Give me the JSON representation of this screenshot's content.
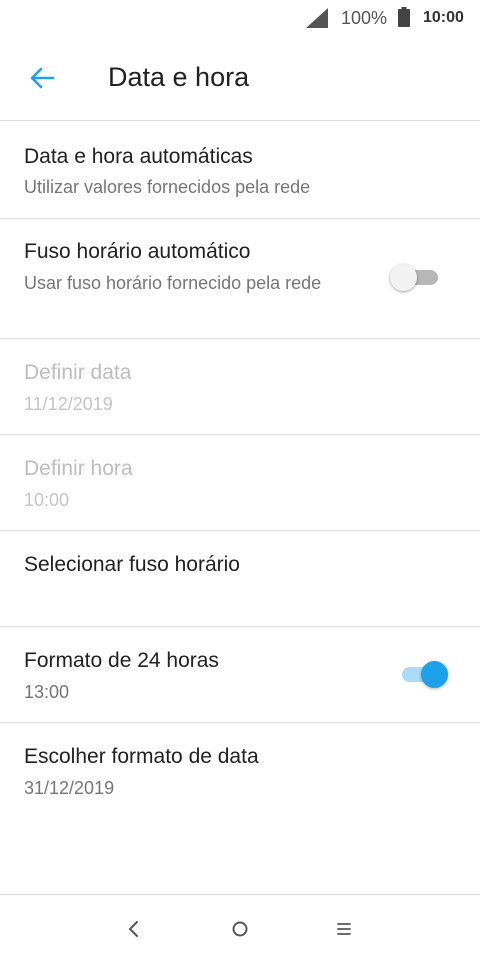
{
  "status_bar": {
    "battery_percent": "100%",
    "time": "10:00",
    "icons": [
      "cell-signal-icon",
      "battery-icon"
    ]
  },
  "app_bar": {
    "title": "Data e hora",
    "back_icon": "arrow-left-icon"
  },
  "settings": {
    "auto_datetime": {
      "title": "Data e hora automáticas",
      "summary": "Utilizar valores fornecidos pela rede"
    },
    "auto_timezone": {
      "title": "Fuso horário automático",
      "summary": "Usar fuso horário fornecido pela rede",
      "enabled": false
    },
    "set_date": {
      "title": "Definir data",
      "value": "11/12/2019",
      "disabled": true
    },
    "set_time": {
      "title": "Definir hora",
      "value": "10:00",
      "disabled": true
    },
    "select_timezone": {
      "title": "Selecionar fuso horário"
    },
    "format_24h": {
      "title": "Formato de 24 horas",
      "value": "13:00",
      "enabled": true
    },
    "date_format": {
      "title": "Escolher formato de data",
      "value": "31/12/2019"
    }
  },
  "nav_bar": {
    "icons": [
      "back-chevron-icon",
      "home-circle-icon",
      "menu-lines-icon"
    ]
  },
  "colors": {
    "accent": "#1da1e8",
    "accent_track": "#a9dcf7",
    "divider": "#dddddd",
    "text_primary": "#212121",
    "text_secondary": "#757575",
    "text_disabled": "#bdbdbd"
  }
}
